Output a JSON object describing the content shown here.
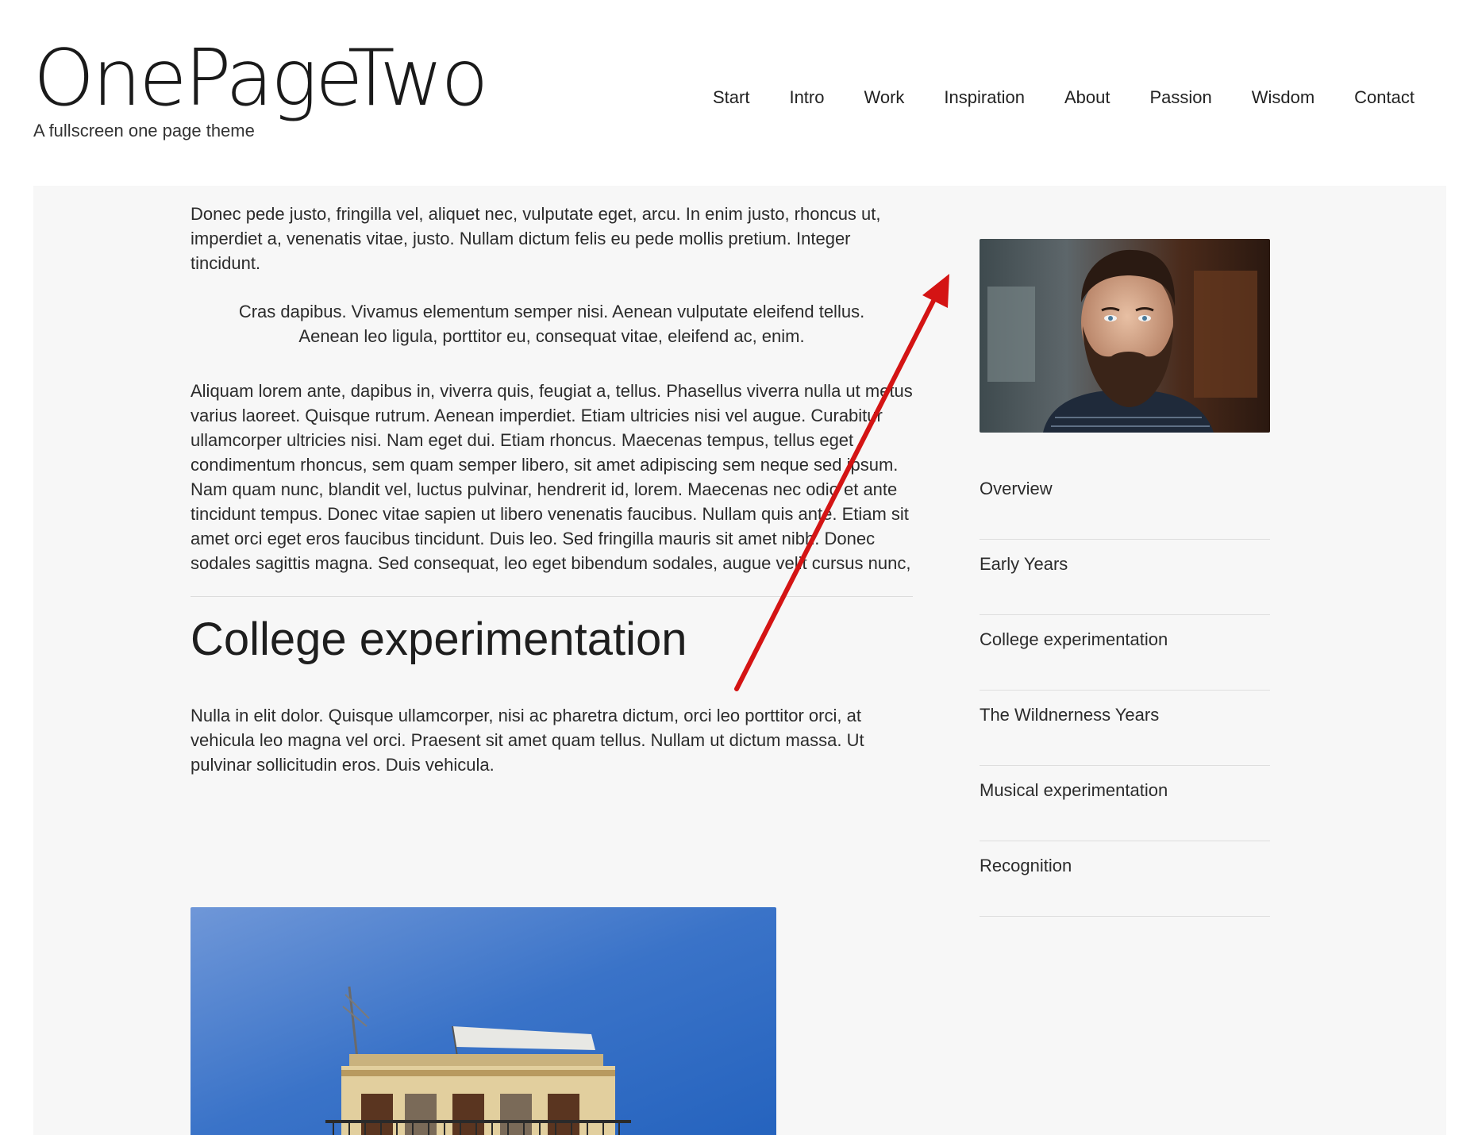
{
  "site": {
    "logo": "OnePageTwo",
    "tagline": "A fullscreen one page theme"
  },
  "nav": {
    "items": [
      {
        "label": "Start"
      },
      {
        "label": "Intro"
      },
      {
        "label": "Work"
      },
      {
        "label": "Inspiration"
      },
      {
        "label": "About"
      },
      {
        "label": "Passion"
      },
      {
        "label": "Wisdom"
      },
      {
        "label": "Contact"
      }
    ]
  },
  "article": {
    "intro": "Donec pede justo, fringilla vel, aliquet nec, vulputate eget, arcu. In enim justo, rhoncus ut, imperdiet a, venenatis vitae, justo. Nullam dictum felis eu pede mollis pretium. Integer tincidunt.",
    "pullquote": "Cras dapibus. Vivamus elementum semper nisi. Aenean vulputate eleifend tellus. Aenean leo ligula, porttitor eu, consequat vitae, eleifend ac, enim.",
    "body": "Aliquam lorem ante, dapibus in, viverra quis, feugiat a, tellus. Phasellus viverra nulla ut metus varius laoreet. Quisque rutrum. Aenean imperdiet. Etiam ultricies nisi vel augue. Curabitur ullamcorper ultricies nisi. Nam eget dui. Etiam rhoncus. Maecenas tempus, tellus eget condimentum rhoncus, sem quam semper libero, sit amet adipiscing sem neque sed ipsum. Nam quam nunc, blandit vel, luctus pulvinar, hendrerit id, lorem. Maecenas nec odio et ante tincidunt tempus. Donec vitae sapien ut libero venenatis faucibus. Nullam quis ante. Etiam sit amet orci eget eros faucibus tincidunt. Duis leo. Sed fringilla mauris sit amet nibh. Donec sodales sagittis magna. Sed consequat, leo eget bibendum sodales, augue velit cursus nunc,",
    "section_heading": "College experimentation",
    "section_body": "Nulla in elit dolor. Quisque ullamcorper, nisi ac pharetra dictum, orci leo porttitor orci, at vehicula leo magna vel orci. Praesent sit amet quam tellus. Nullam ut dictum massa. Ut pulvinar sollicitudin eros. Duis vehicula."
  },
  "sidebar": {
    "items": [
      {
        "label": "Overview"
      },
      {
        "label": "Early Years"
      },
      {
        "label": "College experimentation"
      },
      {
        "label": "The Wildnerness Years"
      },
      {
        "label": "Musical experimentation"
      },
      {
        "label": "Recognition"
      }
    ]
  },
  "colors": {
    "annotation_arrow": "#d41414",
    "panel_background": "#f7f7f7",
    "divider": "#dedede"
  }
}
